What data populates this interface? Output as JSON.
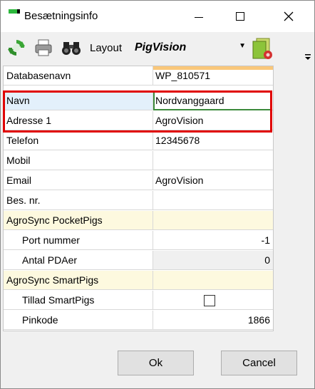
{
  "window": {
    "title": "Besætningsinfo"
  },
  "toolbar": {
    "layout_label": "Layout",
    "layout_value": "PigVision",
    "icons": [
      "refresh-icon",
      "print-icon",
      "binoculars-icon",
      "layout-settings-icon",
      "chevron-down-icon"
    ]
  },
  "grid": {
    "rows": [
      {
        "name": "Databasenavn",
        "value": "WP_810571"
      },
      {
        "name": "Navn",
        "value": "Nordvanggaard"
      },
      {
        "name": "Adresse 1",
        "value": "AgroVision"
      },
      {
        "name": "Telefon",
        "value": "12345678"
      },
      {
        "name": "Mobil",
        "value": ""
      },
      {
        "name": "Email",
        "value": "AgroVision"
      },
      {
        "name": "Bes. nr.",
        "value": ""
      },
      {
        "name": "AgroSync PocketPigs",
        "value": ""
      },
      {
        "name": "Port nummer",
        "value": "-1"
      },
      {
        "name": "Antal PDAer",
        "value": "0"
      },
      {
        "name": "AgroSync SmartPigs",
        "value": ""
      },
      {
        "name": "Tillad SmartPigs",
        "value": false
      },
      {
        "name": "Pinkode",
        "value": "1866"
      }
    ]
  },
  "buttons": {
    "ok": "Ok",
    "cancel": "Cancel"
  },
  "colors": {
    "highlight": "#e00000",
    "category": "#fdf9df",
    "selected": "#e3f0fb",
    "edit_border": "#3c8a3c"
  }
}
